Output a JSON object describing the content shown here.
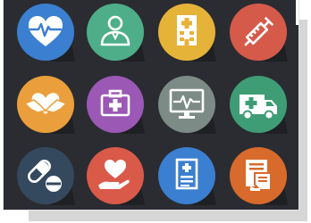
{
  "icons": [
    {
      "name": "heart-pulse-icon",
      "color": "#3b7fd0"
    },
    {
      "name": "doctor-icon",
      "color": "#4eae8a"
    },
    {
      "name": "hospital-building-icon",
      "color": "#e6b339"
    },
    {
      "name": "syringe-icon",
      "color": "#d55a4a"
    },
    {
      "name": "heart-hands-icon",
      "color": "#ea9f3c"
    },
    {
      "name": "medical-kit-icon",
      "color": "#9b58b5"
    },
    {
      "name": "ecg-monitor-icon",
      "color": "#7c8b86"
    },
    {
      "name": "ambulance-icon",
      "color": "#3f9d76"
    },
    {
      "name": "pills-icon",
      "color": "#34495e"
    },
    {
      "name": "heart-in-hand-icon",
      "color": "#d95a49"
    },
    {
      "name": "medical-report-icon",
      "color": "#3b7fd0"
    },
    {
      "name": "clipboard-tablet-icon",
      "color": "#d86a2b"
    }
  ]
}
